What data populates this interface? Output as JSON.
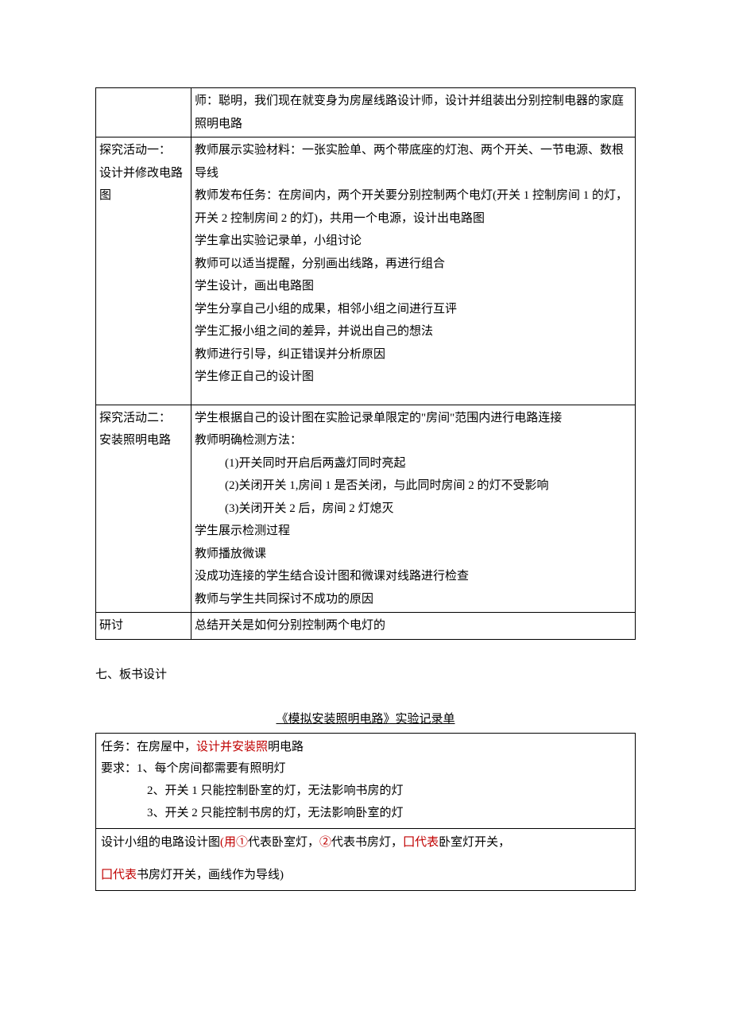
{
  "table": {
    "row0": {
      "left": "",
      "right": "师：聪明，我们现在就变身为房屋线路设计师，设计并组装出分别控制电器的家庭照明电路"
    },
    "row1": {
      "left_line1": "探究活动一：",
      "left_line2": "设计并修改电路图",
      "r1": "教师展示实验材料：一张实脸单、两个带底座的灯泡、两个开关、一节电源、数根导线",
      "r2": "教师发布任务：在房间内，两个开关要分别控制两个电灯(开关 1 控制房间 1 的灯，开关 2 控制房间 2 的灯)，共用一个电源，设计出电路图",
      "r3": "学生拿出实验记录单，小组讨论",
      "r4": "教师可以适当提醒，分别画出线路，再进行组合",
      "r5": "学生设计，画出电路图",
      "r6": "学生分享自己小组的成果，相邻小组之间进行互评",
      "r7": "学生汇报小组之间的差异，并说出自己的想法",
      "r8": "教师进行引导，纠正错误并分析原因",
      "r9": "学生修正自己的设计图"
    },
    "row2": {
      "left_line1": "探究活动二：",
      "left_line2": "安装照明电路",
      "r1": "学生根据自己的设计图在实脸记录单限定的\"房间\"范围内进行电路连接",
      "r2": "教师明确检测方法：",
      "r3": "(1)开关同时开启后两盏灯同时亮起",
      "r4": "(2)关闭开关 1,房间 1 是否关闭，与此同时房间 2 的灯不受影响",
      "r5": "(3)关闭开关 2 后，房间 2 灯熄灭",
      "r6": "学生展示检测过程",
      "r7": "教师播放微课",
      "r8": "没成功连接的学生结合设计图和微课对线路进行检查",
      "r9": "教师与学生共同探讨不成功的原因"
    },
    "row3": {
      "left": "研讨",
      "right": "总结开关是如何分别控制两个电灯的"
    }
  },
  "section_heading": "七、板书设计",
  "worksheet": {
    "title": "《模拟安装照明电路》实验记录单",
    "task_label": "任务：在房屋中，",
    "task_red": "设计并安装照",
    "task_tail": "明电路",
    "req_label": "要求：1、每个房间都需要有照明灯",
    "req2": "2、开关 1 只能控制卧室的灯，无法影响书房的灯",
    "req3": "3、开关 2 只能控制书房的灯，无法影响卧室的灯",
    "design_prefix": "设计小组的电路设计图",
    "design_red1": "(用①",
    "design_black1": "代表卧室灯，",
    "design_red2": "②",
    "design_black2": "代表书房灯，",
    "design_red3": "囗代表",
    "design_black3": "卧室灯开关，",
    "design_red4": "囗代表",
    "design_black4": "书房灯开关，画线作为导线)"
  }
}
